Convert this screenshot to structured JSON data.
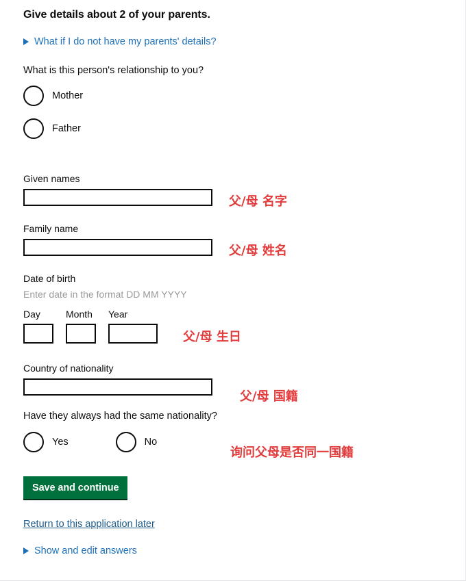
{
  "page": {
    "heading": "Give details about 2 of your parents."
  },
  "details_disclosure": {
    "label": "What if I do not have my parents' details?",
    "arrow_icon": "triangle-right-icon",
    "color": "#1d70b8"
  },
  "relationship": {
    "question": "What is this person's relationship to you?",
    "options": [
      {
        "label": "Mother",
        "selected": false
      },
      {
        "label": "Father",
        "selected": false
      }
    ]
  },
  "fields": {
    "given_names": {
      "label": "Given names",
      "value": "",
      "placeholder": ""
    },
    "family_name": {
      "label": "Family name",
      "value": "",
      "placeholder": ""
    },
    "date_of_birth": {
      "label": "Date of birth",
      "hint": "Enter date in the format DD MM YYYY",
      "day": {
        "label": "Day",
        "value": ""
      },
      "month": {
        "label": "Month",
        "value": ""
      },
      "year": {
        "label": "Year",
        "value": ""
      }
    },
    "country_of_nationality": {
      "label": "Country of nationality",
      "value": "",
      "placeholder": ""
    }
  },
  "same_nationality": {
    "question": "Have they always had the same nationality?",
    "options": [
      {
        "label": "Yes",
        "selected": false
      },
      {
        "label": "No",
        "selected": false
      }
    ]
  },
  "actions": {
    "save_label": "Save and continue",
    "save_color": "#00703c",
    "return_link": "Return to this application later",
    "show_edit_link": "Show and edit answers",
    "show_edit_arrow_icon": "triangle-right-icon",
    "link_color": "#1d5c8a"
  },
  "annotations": {
    "color": "#e23b3b",
    "given_names": "父/母 名字",
    "family_name": "父/母 姓名",
    "date_of_birth": "父/母 生日",
    "country_of_nationality": "父/母 国籍",
    "same_nationality": "询问父母是否同一国籍"
  }
}
